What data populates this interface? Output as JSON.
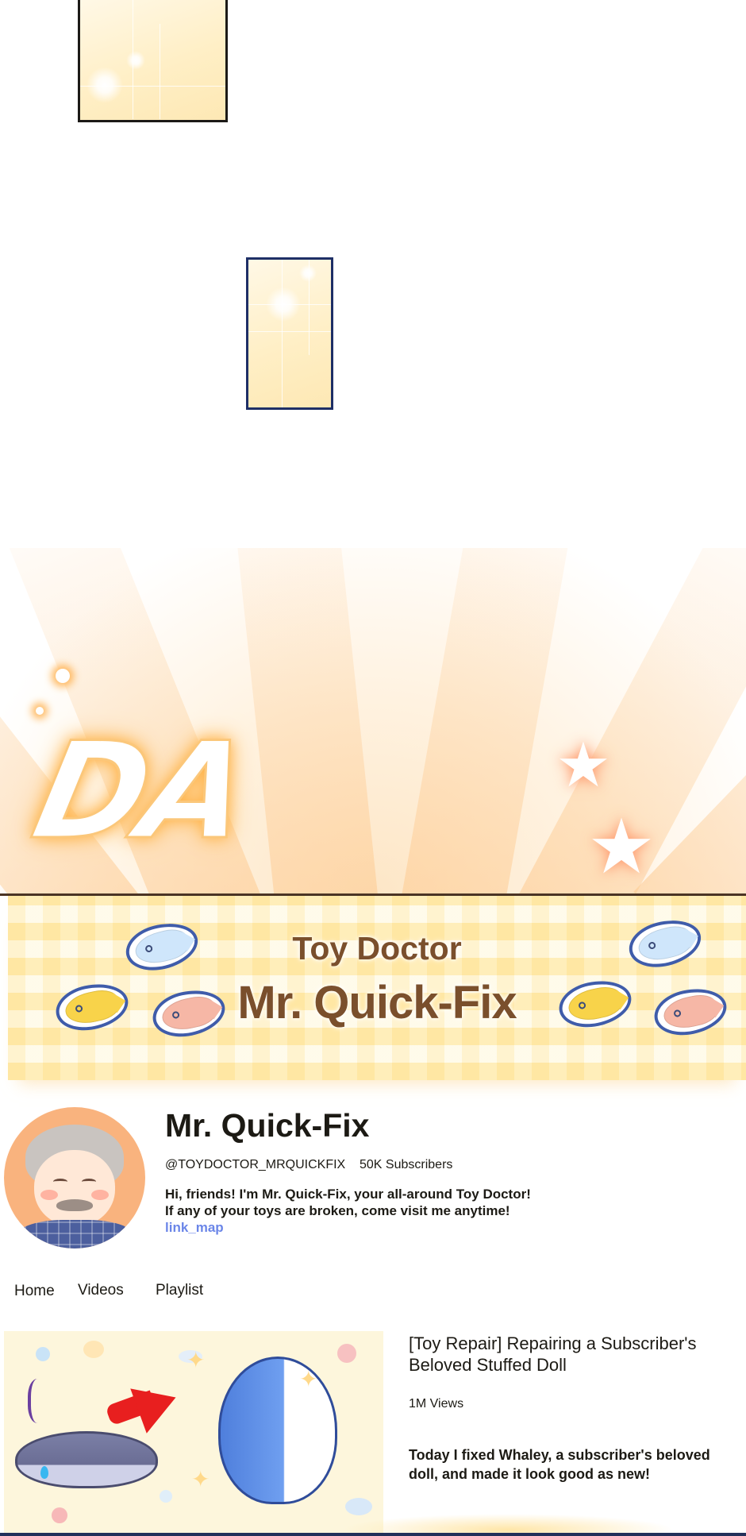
{
  "comic": {
    "sfx_text": "DA",
    "colors": {
      "glow": "#ffb247",
      "panel_fill": "#ffefc6",
      "panel_border": "#1e2f66"
    }
  },
  "banner": {
    "subtitle": "Toy Doctor",
    "title": "Mr. Quick-Fix",
    "colors": {
      "text": "#7a4f2c",
      "plaid": "#fff6d2"
    }
  },
  "profile": {
    "name": "Mr. Quick-Fix",
    "handle": "@TOYDOCTOR_MRQUICKFIX",
    "subscribers": "50K Subscribers",
    "bio_line_1": "Hi, friends! I'm Mr. Quick-Fix, your all-around Toy Doctor!",
    "bio_line_2": "If any of your toys are broken, come visit me anytime!",
    "link": "link_map",
    "colors": {
      "link": "#6b86e8",
      "avatar_bg": "#f9b37e"
    }
  },
  "tabs": [
    {
      "label": "Home"
    },
    {
      "label": "Videos"
    },
    {
      "label": "Playlist"
    }
  ],
  "video": {
    "title": "[Toy Repair] Repairing a Subscriber's Beloved Stuffed Doll",
    "views": "1M Views",
    "description": "Today I fixed Whaley, a subscriber's beloved doll, and made it look good as new!"
  }
}
